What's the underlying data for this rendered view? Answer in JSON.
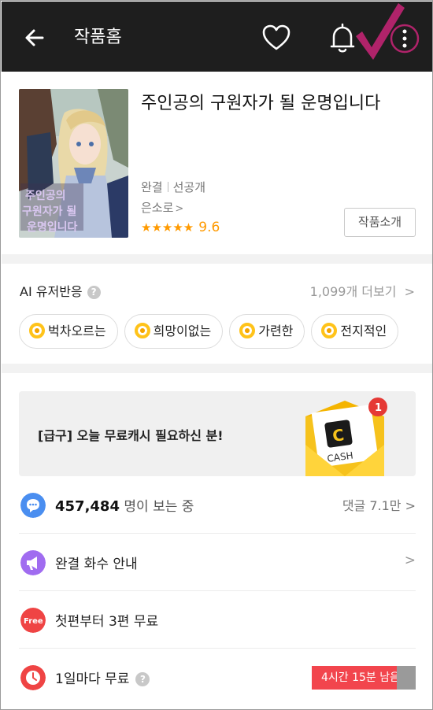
{
  "header": {
    "title": "작품홈"
  },
  "book": {
    "title": "주인공의 구원자가 될 운명입니다",
    "status": "완결",
    "status2": "선공개",
    "author": "은소로",
    "author_chevron": ">",
    "stars": "★★★★★",
    "score": "9.6",
    "intro_button": "작품소개"
  },
  "ai_reactions": {
    "title": "AI 유저반응",
    "help": "?",
    "count_link": "1,099개 더보기",
    "chevron": ">",
    "chips": [
      "벅차오르는",
      "희망이없는",
      "가련한",
      "전지적인"
    ]
  },
  "banner": {
    "text": "[급구] 오늘 무료캐시 필요하신 분!",
    "badge": "1",
    "cash_label": "CASH",
    "cash_letter": "C"
  },
  "rows": {
    "viewers_count": "457,484",
    "viewers_suffix": " 명이 보는 중",
    "comments": "댓글 7.1만 >",
    "episodes_info": "완결 화수 안내",
    "episodes_chevron": ">",
    "free_badge": "Free",
    "free_first": "첫편부터 3편 무료",
    "daily_free": "1일마다 무료",
    "daily_help": "?",
    "timer": "4시간 15분 남음"
  },
  "colors": {
    "header_bg": "#1e1e1e",
    "accent_check": "#b0236a",
    "star": "#ff9a00",
    "timer_red": "#f2454d",
    "viewers_icon": "#4a8ef0",
    "episodes_icon": "#a06cf0",
    "free_icon": "#ef4444",
    "clock_icon": "#ef4444"
  },
  "icons": {
    "back": "arrow-left-icon",
    "heart": "heart-icon",
    "bell": "bell-icon",
    "more": "more-vertical-icon",
    "check": "checkmark-icon",
    "viewers": "chat-bubble-icon",
    "episodes": "megaphone-icon",
    "free": "free-badge-icon",
    "clock": "clock-icon",
    "coin": "coin-icon"
  }
}
